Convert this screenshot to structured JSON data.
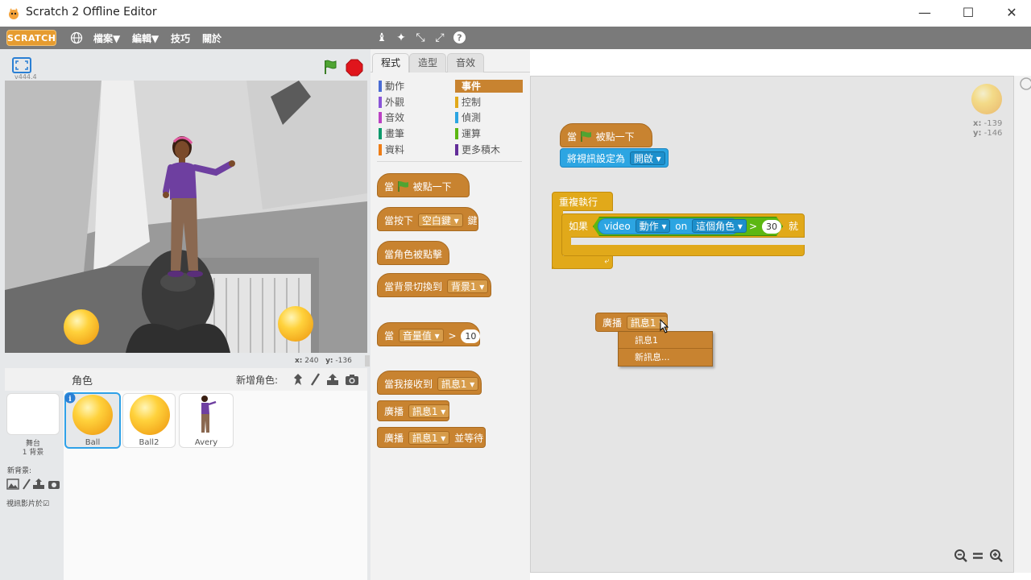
{
  "window": {
    "title": "Scratch 2 Offline Editor"
  },
  "menubar": {
    "logo": "SCRATCH",
    "file": "檔案▼",
    "edit": "編輯▼",
    "tips": "技巧",
    "about": "關於"
  },
  "stage": {
    "version": "v444.4",
    "coords_x": "240",
    "coords_y": "-136",
    "x_label": "x:",
    "y_label": "y:"
  },
  "sprites_pane": {
    "title": "角色",
    "new_sprite": "新增角色:",
    "stage_label": "舞台",
    "stage_backdrops": "1 背景",
    "new_backdrop": "新背景:",
    "video_label": "視訊影片於",
    "sprites": [
      {
        "name": "Ball"
      },
      {
        "name": "Ball2"
      },
      {
        "name": "Avery"
      }
    ]
  },
  "tabs": [
    "程式",
    "造型",
    "音效"
  ],
  "categories": [
    {
      "label": "動作",
      "color": "#4a6cd4"
    },
    {
      "label": "外觀",
      "color": "#8a55d7"
    },
    {
      "label": "音效",
      "color": "#bb42c3"
    },
    {
      "label": "畫筆",
      "color": "#0e9a6c"
    },
    {
      "label": "資料",
      "color": "#ee7d16"
    },
    {
      "label": "事件",
      "color": "#c88330"
    },
    {
      "label": "控制",
      "color": "#e1a91a"
    },
    {
      "label": "偵測",
      "color": "#2ca5e2"
    },
    {
      "label": "運算",
      "color": "#5cb712"
    },
    {
      "label": "更多積木",
      "color": "#632d99"
    }
  ],
  "palette": {
    "when_flag_pre": "當",
    "when_flag_post": "被點一下",
    "when_key_pre": "當按下",
    "when_key_val": "空白鍵",
    "when_key_post": "鍵",
    "when_sprite_clicked": "當角色被點擊",
    "when_backdrop_pre": "當背景切換到",
    "when_backdrop_val": "背景1",
    "when_loud_pre": "當",
    "when_loud_val": "音量值",
    "when_loud_gt": ">",
    "when_loud_num": "10",
    "when_receive_pre": "當我接收到",
    "when_receive_val": "訊息1",
    "broadcast": "廣播",
    "broadcast_val": "訊息1",
    "broadcast_wait_val": "訊息1",
    "broadcast_wait_post": "並等待"
  },
  "scripts": {
    "hat_pre": "當",
    "hat_post": "被點一下",
    "set_video": "將視訊設定為",
    "set_video_val": "開啟",
    "forever": "重複執行",
    "if_label": "如果",
    "video_label": "video",
    "video_attr": "動作",
    "video_on": "on",
    "video_target": "這個角色",
    "gt": ">",
    "threshold": "30",
    "then_label": "就",
    "broadcast": "廣播",
    "broadcast_val": "訊息1",
    "dropdown_items": [
      "訊息1",
      "新訊息..."
    ]
  },
  "script_area": {
    "mouse_x_label": "x:",
    "mouse_x": "-139",
    "mouse_y_label": "y:",
    "mouse_y": "-146"
  }
}
